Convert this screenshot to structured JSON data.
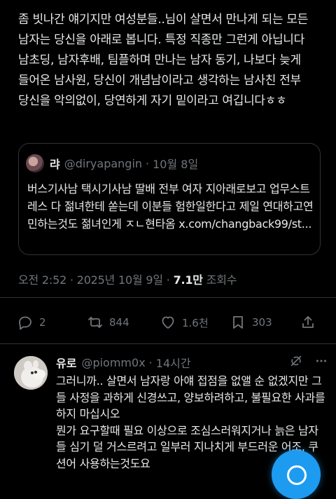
{
  "tweet": {
    "text": "좀 빗나간 얘기지만 여성분들..님이 살면서 만나게 되는 모든 남자는 당신을 아래로 봅니다. 특정 직종만 그런게 아닙니다 남초딩, 남자후배, 팀플하며 만나는 남자 동기, 나보다 늦게 들어온 남사원, 당신이 개념남이라고 생각하는 남사친 전부 당신을 악의없이, 당연하게 자기 밑이라고 여깁니다ㅎㅎ",
    "timestamp": "오전 2:52 · 2025년 10월 9일 · ",
    "views_count": "7.1만",
    "views_label": " 조회수",
    "actions": {
      "replies": "2",
      "retweets": "844",
      "likes": "1.6천",
      "bookmarks": "303"
    }
  },
  "quoted": {
    "name": "랴",
    "handle": "@diryapangin",
    "date": "10월 8일",
    "text": "버스기사남 택시기사남 딸배 전부 여자 지아래로보고 업무스트레스 다 젊녀한테 쏟는데 이분들 험한일한다고 제일 연대하고연민하는것도 젊녀인게 ㅈㄴ현타옴 x.com/changback99/st..."
  },
  "reply": {
    "name": "유로",
    "handle": "@piomm0x",
    "time": "14시간",
    "text": "그러니까.. 살면서 남자랑 아얘 접점을 없앨 순 없겠지만 그들 사정을 과하게 신경쓰고, 양보하려하고, 불필요한 사과를 하지 마십시오\n뭔가 요구할때 필요 이상으로 조심스러워지거나 늙은 남자들 심기 덜 거스르려고 일부러 지나치게 부드러운 어조, 쿠션어 사용하는것도요"
  },
  "colors": {
    "background": "#000000",
    "text": "#e7e9ea",
    "muted": "#71767b",
    "border": "#2f3336",
    "accent": "#1d9bf0"
  }
}
